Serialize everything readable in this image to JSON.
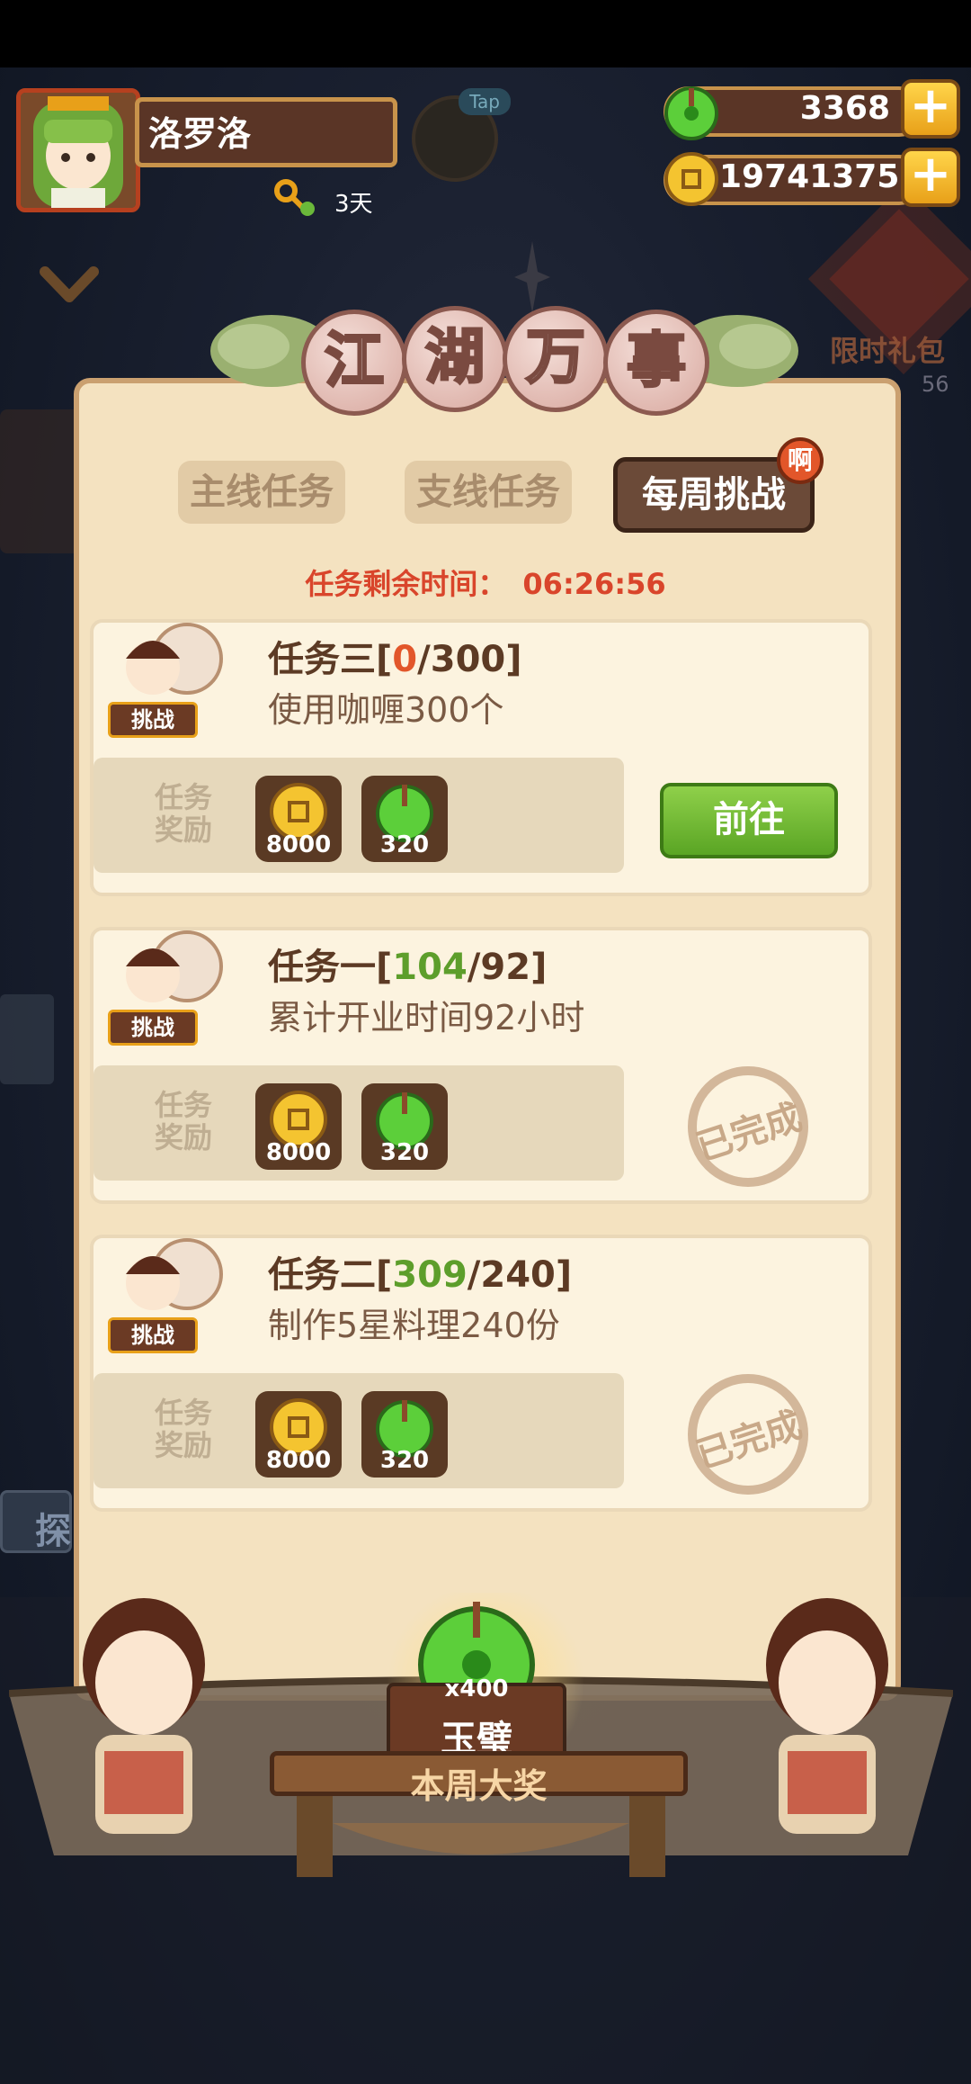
{
  "player": {
    "name": "洛罗洛",
    "days": "3天"
  },
  "tap_label": "Tap",
  "resources": {
    "jade": "3368",
    "coins": "19741375"
  },
  "side_promo": {
    "label": "限时礼包",
    "timer": "56"
  },
  "title_chars": [
    "江",
    "湖",
    "万",
    "事"
  ],
  "tabs": [
    {
      "label": "主线任务",
      "active": false
    },
    {
      "label": "支线任务",
      "active": false
    },
    {
      "label": "每周挑战",
      "active": true
    }
  ],
  "tab_badge": "啊",
  "timer": {
    "label": "任务剩余时间：",
    "value": "06:26:56"
  },
  "reward_label": "任务奖励",
  "challenge_badge": "挑战",
  "tasks": [
    {
      "name": "任务三",
      "progress": "0",
      "target": "300",
      "desc": "使用咖喱300个",
      "rewards": [
        "8000",
        "320"
      ],
      "status": "go",
      "button": "前往"
    },
    {
      "name": "任务一",
      "progress": "104",
      "target": "92",
      "desc": "累计开业时间92小时",
      "rewards": [
        "8000",
        "320"
      ],
      "status": "done",
      "stamp": "已完成"
    },
    {
      "name": "任务二",
      "progress": "309",
      "target": "240",
      "desc": "制作5星料理240份",
      "rewards": [
        "8000",
        "320"
      ],
      "status": "done",
      "stamp": "已完成"
    }
  ],
  "grand_prize": {
    "count": "x400",
    "name": "玉璧",
    "label": "本周大奖"
  },
  "side_left_label": "探",
  "colors": {
    "accent_red": "#d9452b",
    "done_green": "#5d9e2b",
    "panel_bg": "#f4e2c0"
  },
  "icons": [
    "jade-icon",
    "coin-icon",
    "plus-icon",
    "key-icon",
    "chevron-down-icon",
    "star-icon"
  ]
}
